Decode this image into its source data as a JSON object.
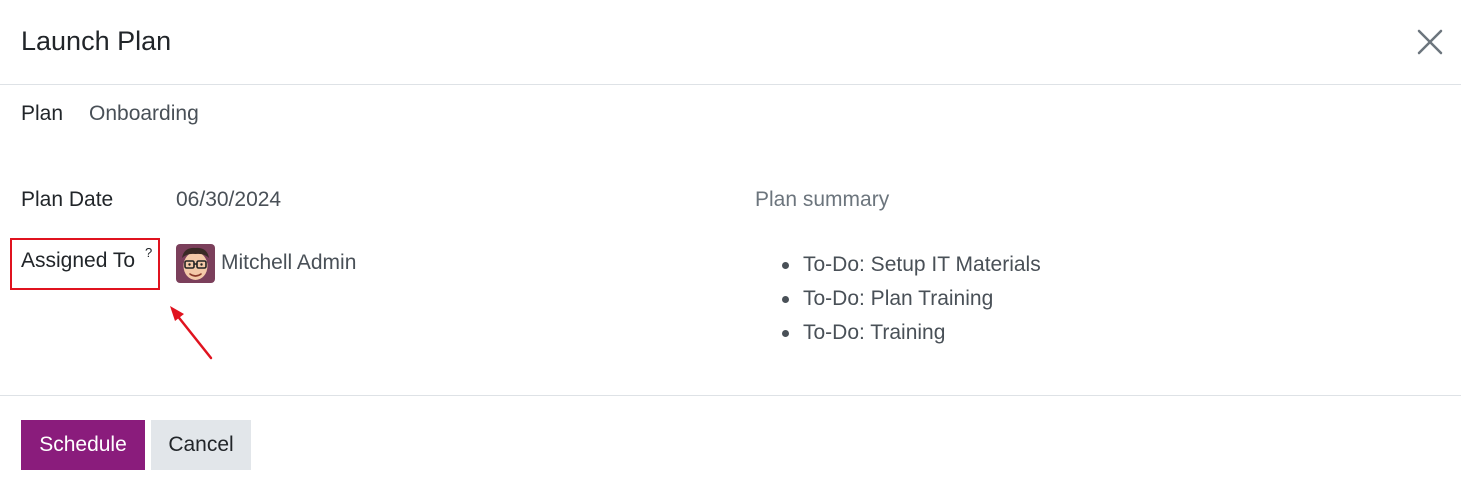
{
  "dialog": {
    "title": "Launch Plan",
    "close_icon": "close-icon"
  },
  "form": {
    "plan_label": "Plan",
    "plan_value": "Onboarding",
    "plan_date_label": "Plan Date",
    "plan_date_value": "06/30/2024",
    "assigned_to_label": "Assigned To",
    "assigned_to_help": "?",
    "assigned_to_value": "Mitchell Admin",
    "avatar_icon": "user-avatar-icon"
  },
  "summary": {
    "title": "Plan summary",
    "items": [
      "To-Do: Setup IT Materials",
      "To-Do: Plan Training",
      "To-Do: Training"
    ]
  },
  "footer": {
    "schedule_label": "Schedule",
    "cancel_label": "Cancel"
  },
  "colors": {
    "primary": "#8a1c7c",
    "secondary": "#e2e6ea",
    "annotation": "#e0131f"
  }
}
